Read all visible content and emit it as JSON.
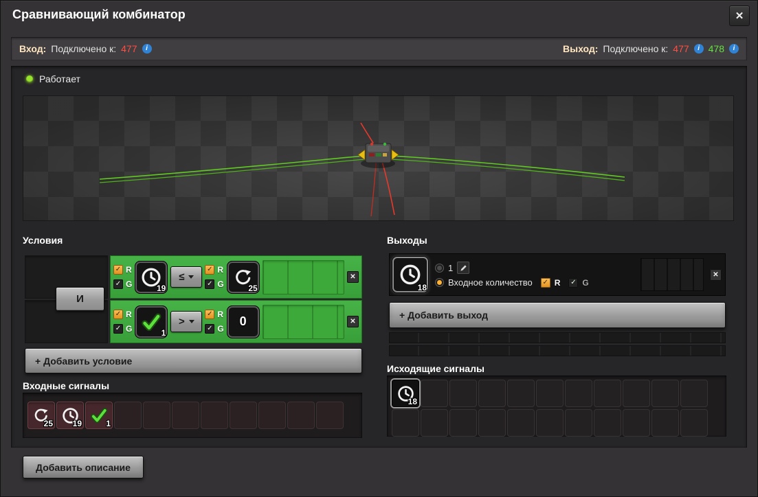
{
  "window": {
    "title": "Сравнивающий комбинатор",
    "close": "✕"
  },
  "glyphs": {
    "check": "✓",
    "info": "i"
  },
  "connections": {
    "input": {
      "label": "Вход:",
      "text": "Подключено к:",
      "ids": [
        {
          "value": "477"
        }
      ]
    },
    "output": {
      "label": "Выход:",
      "text": "Подключено к:",
      "ids": [
        {
          "value": "477"
        },
        {
          "value": "478"
        }
      ]
    }
  },
  "status": {
    "label": "Работает"
  },
  "conditions": {
    "title": "Условия",
    "operator": "И",
    "network_labels": {
      "red": "R",
      "green": "G"
    },
    "rows": [
      {
        "first": {
          "icon": "clock-icon",
          "count": "19"
        },
        "comparator": "≤",
        "second": {
          "icon": "recycle-icon",
          "count": "25"
        },
        "close": "✕"
      },
      {
        "first": {
          "icon": "checkmark-icon",
          "count": "1"
        },
        "comparator": ">",
        "second": {
          "icon": "constant",
          "value": "0"
        },
        "close": "✕"
      }
    ],
    "add_label": "+ Добавить условие"
  },
  "input_signals": {
    "title": "Входные сигналы",
    "items": [
      {
        "icon": "recycle-icon",
        "count": "25"
      },
      {
        "icon": "clock-icon",
        "count": "19"
      },
      {
        "icon": "checkmark-icon",
        "count": "1"
      }
    ]
  },
  "outputs": {
    "title": "Выходы",
    "row": {
      "signal": {
        "icon": "clock-icon",
        "count": "18"
      },
      "constant_option": {
        "value": "1"
      },
      "input_count_option": {
        "label": "Входное количество"
      },
      "networks": {
        "red": "R",
        "green": "G"
      },
      "close": "✕"
    },
    "add_label": "+ Добавить выход"
  },
  "outgoing_signals": {
    "title": "Исходящие сигналы",
    "items": [
      {
        "icon": "clock-icon",
        "count": "18"
      }
    ]
  },
  "footer": {
    "add_description": "Добавить описание"
  },
  "colors": {
    "accent_gold": "#ffe6c0",
    "id_red": "#ff4f45",
    "id_green": "#63e23e",
    "condition_green": "#3fae3f",
    "wire_green": "#5fcc1f",
    "wire_red": "#e8392b"
  }
}
